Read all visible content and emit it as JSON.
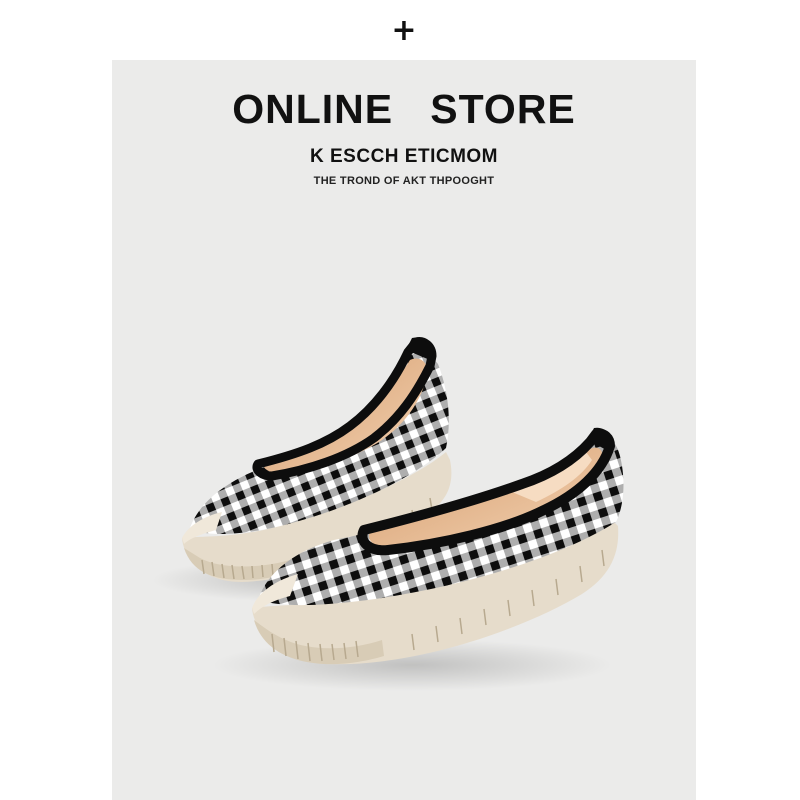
{
  "top_mark": "+",
  "banner": {
    "title": "ONLINE   STORE",
    "subtitle": "K ESCCH ETICMOM",
    "tagline": "THE TROND OF AKT THPOOGHT"
  },
  "colors": {
    "background": "#ebebea",
    "text": "#111111",
    "sole": "#e6dccb",
    "lining": "#e9c09a",
    "check_dark": "#111111",
    "check_light": "#ffffff"
  },
  "product": {
    "image": "black-white-gingham-knit-slip-on-flats-pair"
  }
}
